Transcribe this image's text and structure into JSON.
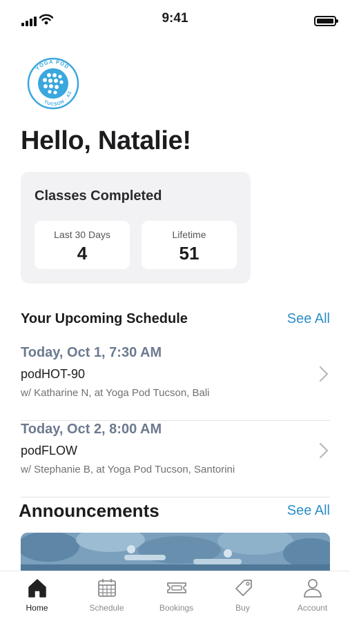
{
  "status_bar": {
    "time": "9:41"
  },
  "logo": {
    "top_text": "YOGA POD",
    "bottom_text": "TUCSON · AZ"
  },
  "greeting": "Hello, Natalie!",
  "classes_completed": {
    "title": "Classes Completed",
    "stats": [
      {
        "label": "Last 30 Days",
        "value": "4"
      },
      {
        "label": "Lifetime",
        "value": "51"
      }
    ]
  },
  "upcoming": {
    "title": "Your Upcoming Schedule",
    "see_all": "See All",
    "items": [
      {
        "date": "Today, Oct 1, 7:30 AM",
        "class": "podHOT-90",
        "detail": "w/ Katharine N, at Yoga Pod Tucson, Bali"
      },
      {
        "date": "Today, Oct 2, 8:00 AM",
        "class": "podFLOW",
        "detail": "w/ Stephanie B, at Yoga Pod Tucson, Santorini"
      }
    ]
  },
  "announcements": {
    "title": "Announcements",
    "see_all": "See All"
  },
  "tabs": [
    {
      "label": "Home",
      "icon": "home-icon",
      "active": true
    },
    {
      "label": "Schedule",
      "icon": "calendar-icon",
      "active": false
    },
    {
      "label": "Bookings",
      "icon": "ticket-icon",
      "active": false
    },
    {
      "label": "Buy",
      "icon": "tag-icon",
      "active": false
    },
    {
      "label": "Account",
      "icon": "user-icon",
      "active": false
    }
  ],
  "colors": {
    "accent": "#2c8fc9",
    "logo": "#3aa7dd",
    "date_text": "#6c7a8f",
    "card_bg": "#f2f2f4"
  }
}
